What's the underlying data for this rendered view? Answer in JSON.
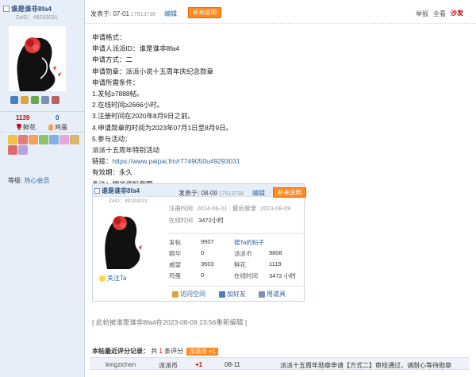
{
  "user": {
    "name": "谁是谁非8fa4",
    "id_label": "ZxID：49293031",
    "flowers": "1139",
    "flowers_label": "鲜花",
    "eggs": "0",
    "eggs_label": "鸡蛋",
    "level_prefix": "等级:",
    "level": "热心会员"
  },
  "post": {
    "time": "发表于: 07-01",
    "time_id": "17813738",
    "edit": "编辑",
    "supplement": "补充说明",
    "report": "举报",
    "viewall": "全看",
    "floor": "沙发"
  },
  "content": {
    "lines": [
      "申请格式：",
      "申请人派派ID：谁是谁非8fa4",
      "申请方式：二",
      "申请勋章：派派小说十五周年庆纪念勋章",
      "申请所需条件：",
      "1.发帖≥7888帖。",
      "2.在线时间≥2666小时。",
      "3.注册时间在2020年8月9日之前。",
      "4.申请勋章的时间为2023年07月1日至8月9日。",
      "5.参与活动：",
      "派派十五周年特别活动"
    ],
    "link_label": "链接：",
    "link_url": "https://www.paipai.fm/r7749050u49293031",
    "validity": "有效期：永久",
    "note": "备注：相关资料截图。"
  },
  "quote": {
    "name": "谁是谁非8fa4",
    "id_label": "ZxID：49293031",
    "time": "发表于: 08-09",
    "time_id": "17813738",
    "edit": "编辑",
    "supplement": "补充说明",
    "reg_label": "注册时间",
    "reg_value": "2014-06-01",
    "last_label": "最后登录",
    "last_value": "2023-08-09",
    "online_label": "在线时间",
    "online_value": "3472小时",
    "grid": [
      {
        "k": "发帖",
        "v": "9907",
        "k2": "搜Ta的帖子",
        "v2": ""
      },
      {
        "k": "精华",
        "v": "0",
        "k2": "派派币",
        "v2": "9808"
      },
      {
        "k": "威望",
        "v": "3503",
        "k2": "鲜花",
        "v2": "1119"
      },
      {
        "k": "鸡蛋",
        "v": "0",
        "k2": "在线时间",
        "v2": "3472 小时"
      }
    ],
    "follow": "关注Ta",
    "visit": "访问空间",
    "add_friend": "加好友",
    "use_item": "用道具"
  },
  "edit_note": "[ 此帖被谁是谁非8fa4在2023-08-09 23:56重新编辑 ]",
  "rating": {
    "label": "本帖最近评分记录：",
    "total_prefix": "共",
    "total": "1",
    "total_suffix": "条评分",
    "tag": "派派币 +1",
    "row": {
      "user": "lengzichen",
      "type": "派派币",
      "value": "+1",
      "date": "08-11",
      "reason": "派派十五周年勋章申请【方式二】审核通过，请耐心等待勋章"
    }
  },
  "colors": {
    "accent": "#ff8a1f",
    "link": "#336699",
    "sidebar": "#e8eef7"
  }
}
